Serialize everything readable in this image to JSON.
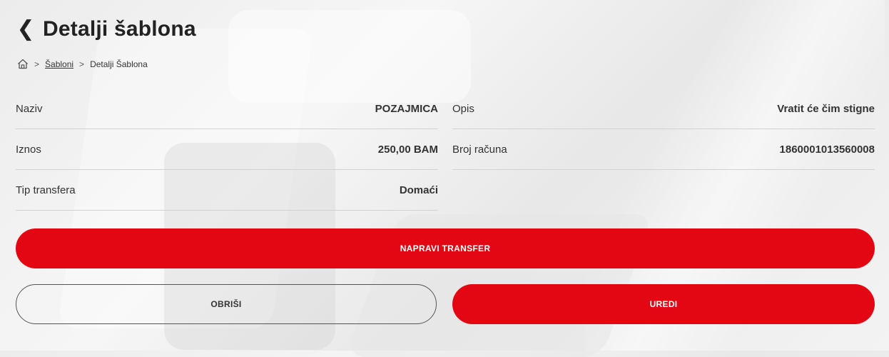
{
  "header": {
    "back_icon": "chevron-left-icon",
    "title": "Detalji šablona"
  },
  "breadcrumb": {
    "home_icon": "home-icon",
    "separator": ">",
    "items": [
      "Šabloni",
      "Detalji Šablona"
    ]
  },
  "details": {
    "left": [
      {
        "label": "Naziv",
        "value": "POZAJMICA"
      },
      {
        "label": "Iznos",
        "value": "250,00 BAM"
      },
      {
        "label": "Tip transfera",
        "value": "Domaći"
      }
    ],
    "right": [
      {
        "label": "Opis",
        "value": "Vratit će čim stigne"
      },
      {
        "label": "Broj računa",
        "value": "1860001013560008"
      }
    ]
  },
  "actions": {
    "transfer_label": "NAPRAVI TRANSFER",
    "delete_label": "OBRIŠI",
    "edit_label": "UREDI"
  },
  "colors": {
    "accent": "#e30613",
    "text": "#222222",
    "divider": "#d2d2d2"
  }
}
